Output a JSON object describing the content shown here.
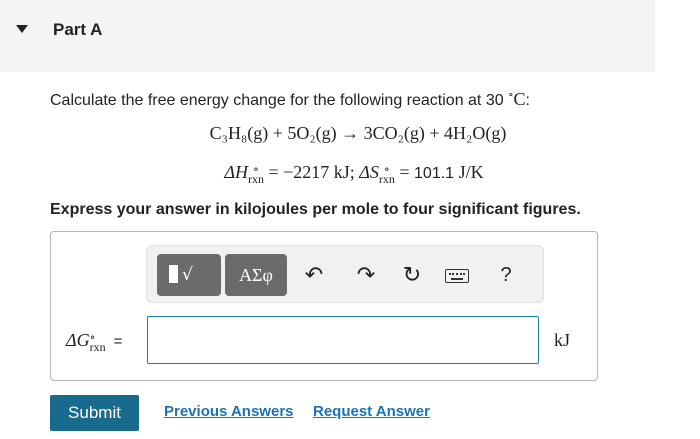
{
  "part": {
    "title": "Part A",
    "toggle_icon": "caret-down-icon"
  },
  "question": {
    "prefix": "Calculate the free energy change for the following reaction at 30",
    "degree": "∘",
    "unit": "C",
    "suffix": ":"
  },
  "reaction": {
    "lhs1": "C₃H₈(g) + 5O₂(g)",
    "arrow": "→",
    "rhs": "3CO₂(g) + 4H₂O(g)"
  },
  "thermo": {
    "dh_symbol": "ΔH",
    "dh_sup": "∘",
    "dh_sub": "rxn",
    "dh_value": "= −2217",
    "dh_unit": "kJ; ",
    "ds_symbol": "ΔS",
    "ds_sup": "∘",
    "ds_sub": "rxn",
    "ds_eq": "=",
    "ds_value": "101.1",
    "ds_unit": "J/K"
  },
  "instruction": "Express your answer in kilojoules per mole to four significant figures.",
  "toolbar": {
    "templates_root": "√",
    "symbols_label": "ΑΣφ",
    "undo_glyph": "↶",
    "redo_glyph": "↷",
    "reset_glyph": "↻",
    "help_label": "?"
  },
  "answer": {
    "label_symbol": "ΔG",
    "label_sup": "∘",
    "label_sub": "rxn",
    "label_eq": "=",
    "value": "",
    "unit": "kJ"
  },
  "actions": {
    "submit_label": "Submit",
    "previous_answers_label": "Previous Answers",
    "request_answer_label": "Request Answer"
  },
  "colors": {
    "accent": "#186b8c",
    "link": "#1a73b6",
    "input_border": "#1a7fa0",
    "header_bg": "#f4f4f4"
  }
}
